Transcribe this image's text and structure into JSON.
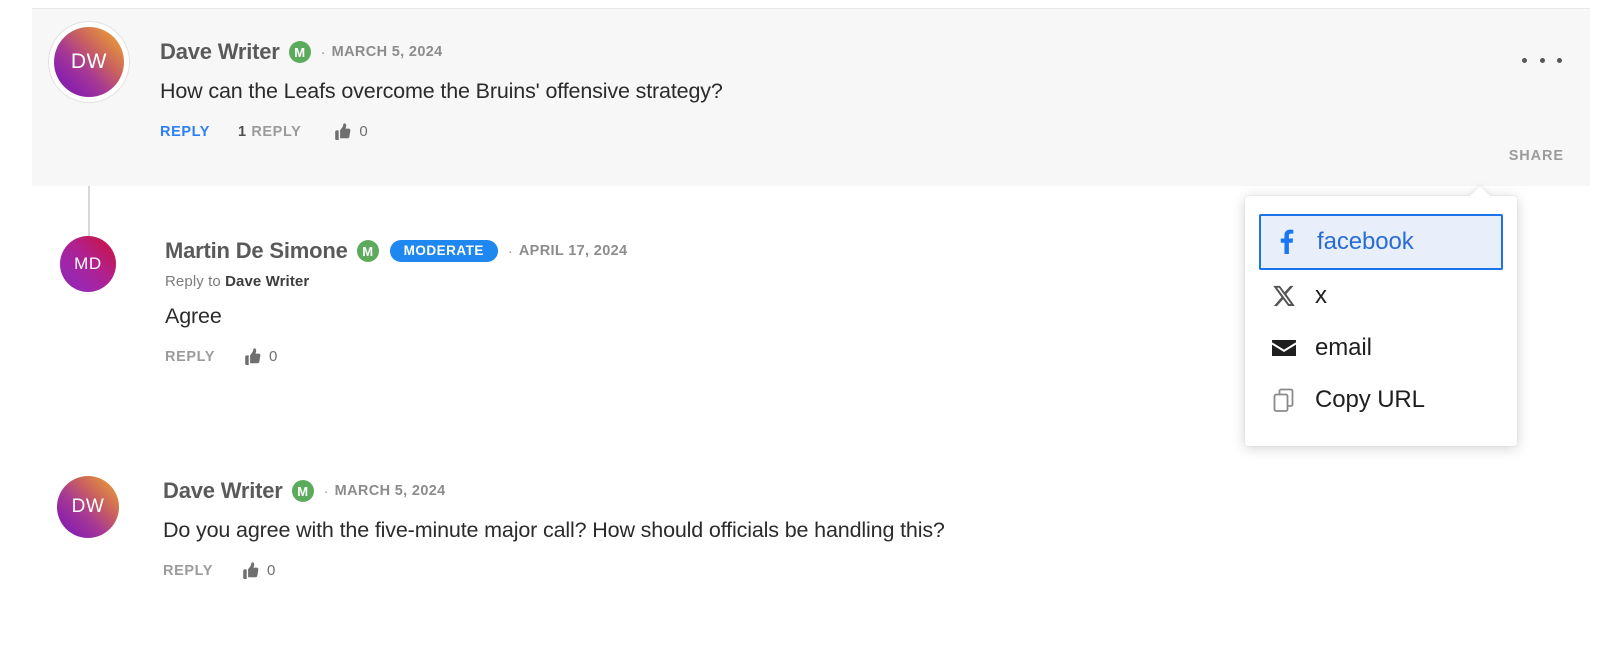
{
  "thread": {
    "comments": [
      {
        "id": "comment-1",
        "avatar_initials": "DW",
        "author": "Dave Writer",
        "member_badge": "M",
        "separator": "·",
        "timestamp": "MARCH 5, 2024",
        "text": "How can the Leafs overcome the Bruins' offensive strategy?",
        "reply_label": "REPLY",
        "replies_count_bold": "1",
        "replies_count_label": "REPLY",
        "like_count": "0",
        "share_label": "SHARE",
        "highlighted": true
      },
      {
        "id": "comment-2",
        "avatar_initials": "MD",
        "author": "Martin De Simone",
        "member_badge": "M",
        "moderate_badge": "MODERATE",
        "separator": "·",
        "timestamp": "APRIL 17, 2024",
        "reply_to_prefix": "Reply to ",
        "reply_to_name": "Dave Writer",
        "text": "Agree",
        "reply_label": "REPLY",
        "like_count": "0"
      },
      {
        "id": "comment-3",
        "avatar_initials": "DW",
        "author": "Dave Writer",
        "member_badge": "M",
        "separator": "·",
        "timestamp": "MARCH 5, 2024",
        "text": "Do you agree with the five-minute major call? How should officials be handling this?",
        "reply_label": "REPLY",
        "like_count": "0"
      }
    ]
  },
  "share_menu": {
    "items": [
      {
        "icon": "facebook-icon",
        "label": "facebook",
        "focused": true
      },
      {
        "icon": "x-twitter-icon",
        "label": "x",
        "focused": false
      },
      {
        "icon": "email-icon",
        "label": "email",
        "focused": false
      },
      {
        "icon": "copy-url-icon",
        "label": "Copy URL",
        "focused": false
      }
    ]
  },
  "colors": {
    "highlight_background": "#f7f7f7",
    "link_blue": "#2d7ff9",
    "moderate_badge_blue": "#1f87f0",
    "member_badge_green": "#5cab5c",
    "focus_outline_blue": "#1a73e8",
    "focus_fill_blue": "#e8effb",
    "facebook_blue": "#1877f2",
    "muted_text": "#9b9b9b",
    "body_text": "#2b2b2b"
  }
}
